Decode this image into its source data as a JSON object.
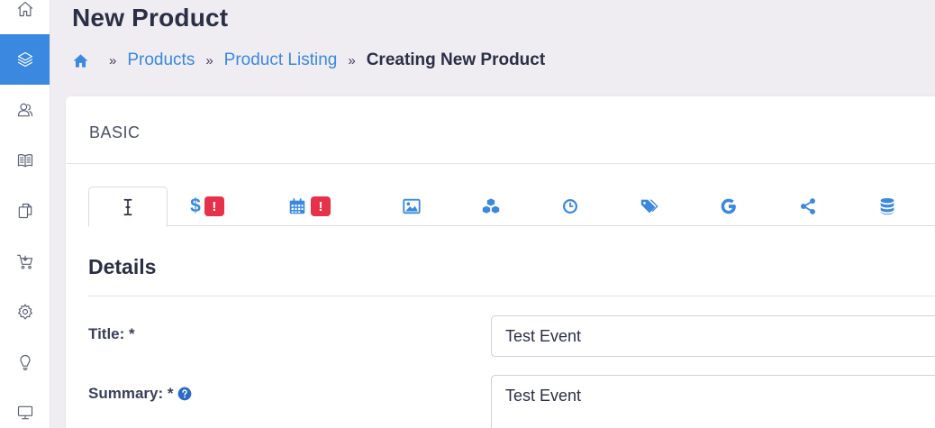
{
  "header": {
    "title": "New Product"
  },
  "breadcrumb": {
    "home_icon": "home-icon",
    "separator": "»",
    "items": [
      "Products",
      "Product Listing"
    ],
    "current": "Creating New Product"
  },
  "sidebar": {
    "items": [
      {
        "icon": "home-icon",
        "active": false
      },
      {
        "icon": "layers-icon",
        "active": true
      },
      {
        "icon": "users-icon",
        "active": false
      },
      {
        "icon": "book-icon",
        "active": false
      },
      {
        "icon": "copy-icon",
        "active": false
      },
      {
        "icon": "cart-icon",
        "active": false
      },
      {
        "icon": "gear-icon",
        "active": false
      },
      {
        "icon": "lightbulb-icon",
        "active": false
      },
      {
        "icon": "monitor-icon",
        "active": false
      }
    ]
  },
  "card": {
    "header_label": "BASIC"
  },
  "tabs": [
    {
      "icon": "text-cursor-icon",
      "active": true,
      "badge": ""
    },
    {
      "icon": "dollar-icon",
      "label": "$",
      "active": false,
      "badge": "!"
    },
    {
      "icon": "calendar-icon",
      "active": false,
      "badge": "!"
    },
    {
      "icon": "image-icon",
      "active": false,
      "badge": ""
    },
    {
      "icon": "cubes-icon",
      "active": false,
      "badge": ""
    },
    {
      "icon": "clock-icon",
      "active": false,
      "badge": ""
    },
    {
      "icon": "tags-icon",
      "active": false,
      "badge": ""
    },
    {
      "icon": "google-icon",
      "active": false,
      "badge": ""
    },
    {
      "icon": "share-icon",
      "active": false,
      "badge": ""
    },
    {
      "icon": "database-icon",
      "active": false,
      "badge": ""
    }
  ],
  "details": {
    "section_title": "Details",
    "title_label": "Title: *",
    "title_value": "Test Event",
    "summary_label": "Summary: *",
    "summary_help_icon": "question-circle-icon",
    "summary_value": "Test Event"
  },
  "colors": {
    "accent": "#3a88e0",
    "badge": "#e7314a",
    "background": "#efedf2"
  }
}
